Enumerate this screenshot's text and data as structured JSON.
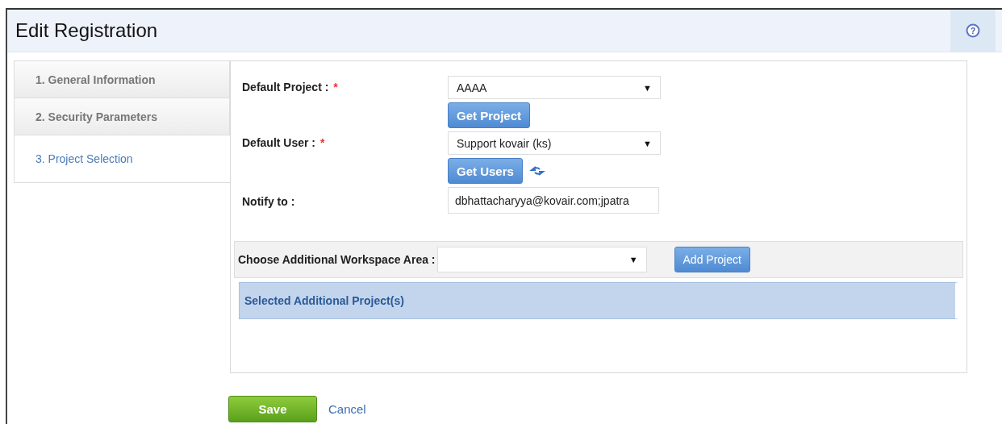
{
  "window": {
    "title": "Edit Registration"
  },
  "steps": [
    {
      "label": "1. General Information",
      "selected": false
    },
    {
      "label": "2. Security Parameters",
      "selected": false
    },
    {
      "label": "3. Project Selection",
      "selected": true
    }
  ],
  "form": {
    "default_project": {
      "label": "Default Project :",
      "required": true,
      "value": "AAAA",
      "button": "Get Project"
    },
    "default_user": {
      "label": "Default User :",
      "required": true,
      "value": "Support kovair (ks)",
      "button": "Get Users"
    },
    "notify_to": {
      "label": "Notify to :",
      "value": "dbhattacharyya@kovair.com;jpatra"
    }
  },
  "workspace": {
    "label": "Choose Additional Workspace Area :",
    "button": "Add Project"
  },
  "help": "?",
  "selected_projects": {
    "title": "Selected Additional Project(s)"
  },
  "required_mark": "*",
  "dropdown_arrow": "▼",
  "actions": {
    "save": "Save",
    "cancel": "Cancel"
  }
}
